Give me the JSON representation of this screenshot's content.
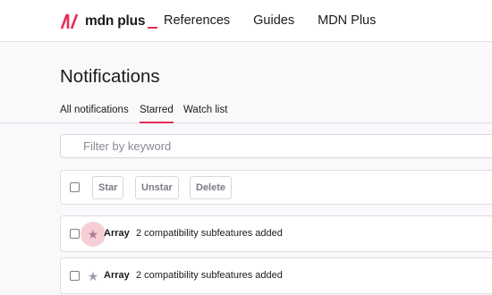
{
  "header": {
    "logo": "mdn plus",
    "nav": [
      "References",
      "Guides",
      "MDN Plus"
    ]
  },
  "page": {
    "title": "Notifications"
  },
  "tabs": [
    "All notifications",
    "Starred",
    "Watch list"
  ],
  "active_tab": "Starred",
  "filter": {
    "placeholder": "Filter by keyword"
  },
  "toolbar": {
    "star_label": "Star",
    "unstar_label": "Unstar",
    "delete_label": "Delete"
  },
  "notifications": [
    {
      "title": "Array",
      "text": "2 compatibility subfeatures added",
      "starred": true,
      "hovered": true
    },
    {
      "title": "Array",
      "text": "2 compatibility subfeatures added",
      "starred": true,
      "hovered": false
    }
  ],
  "icons": {
    "logo": "mdn-logo-icon",
    "star": "star-icon"
  },
  "colors": {
    "accent": "#e52d54",
    "star_hover_bg": "#f6cfd6",
    "star_active": "#b07c99",
    "star_default": "#9d9ca8"
  }
}
